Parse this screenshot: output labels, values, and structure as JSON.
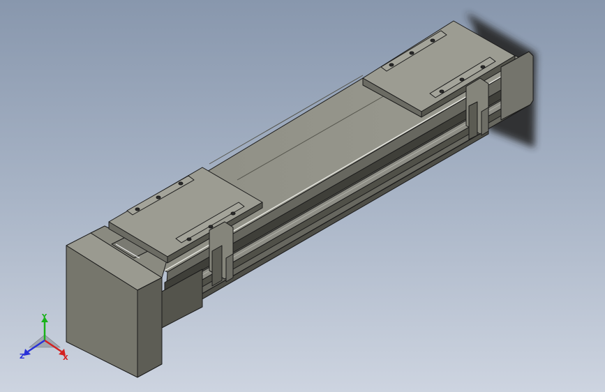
{
  "viewport": {
    "background_top": "#8897ad",
    "background_bottom": "#cdd4e0",
    "model": "linear-module-actuator",
    "colors": {
      "face_top": "#8f8f85",
      "face_left": "#76766c",
      "face_front": "#5a5a52",
      "edge": "#1a1a1a",
      "shadow": "#2b2b2b"
    }
  },
  "triad": {
    "x_label": "X",
    "y_label": "Y",
    "z_label": "Z",
    "x_color": "#d42020",
    "y_color": "#19b219",
    "z_color": "#2830d8"
  }
}
